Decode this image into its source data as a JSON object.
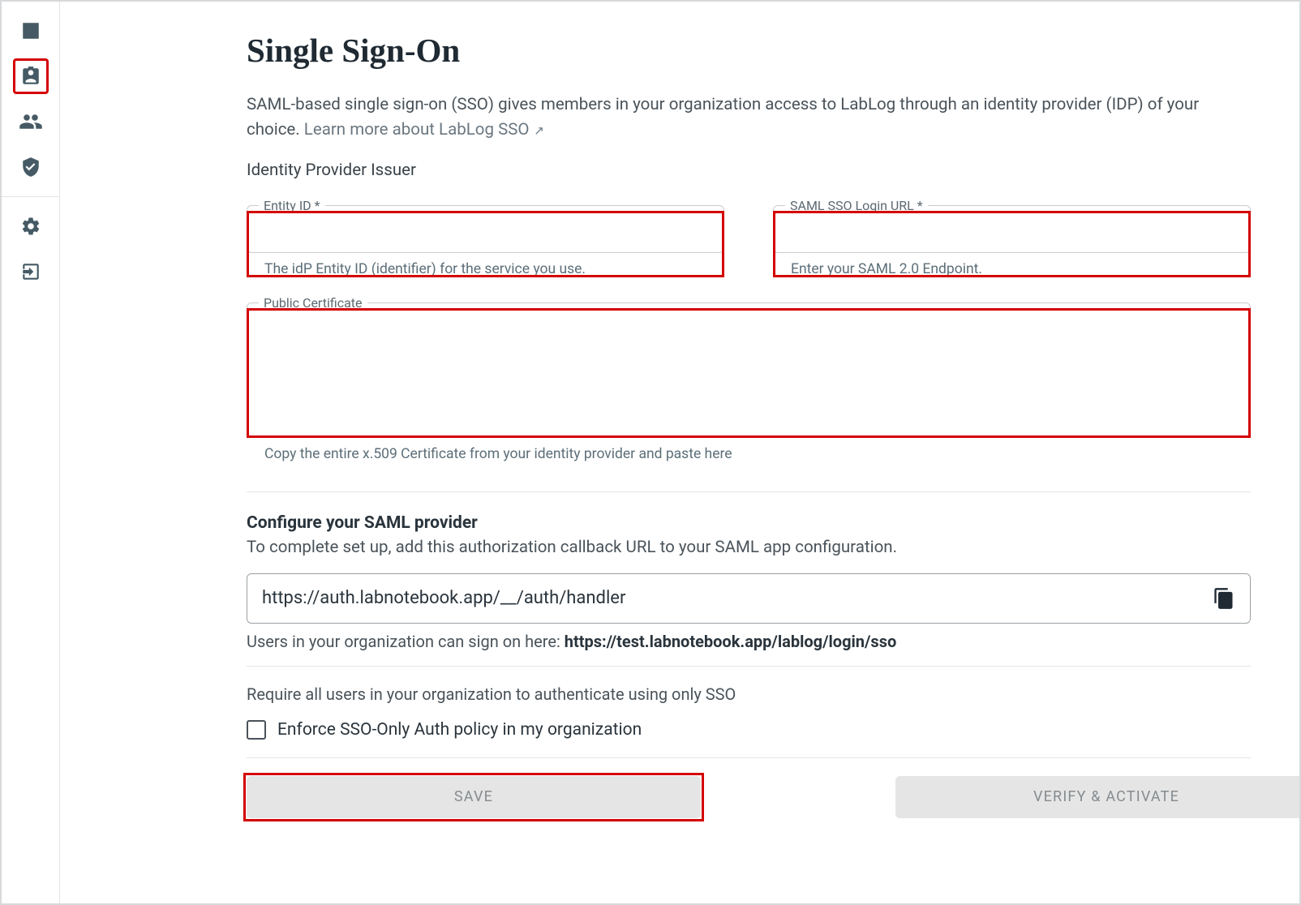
{
  "page": {
    "title": "Single Sign-On",
    "intro_text": "SAML-based single sign-on (SSO) gives members in your organization access to LabLog through an identity provider (IDP) of your choice. ",
    "learn_more": "Learn more about LabLog SSO",
    "section_label": "Identity Provider Issuer"
  },
  "fields": {
    "entity_id": {
      "label": "Entity ID *",
      "value": "",
      "helper": "The idP Entity ID (identifier) for the service you use."
    },
    "login_url": {
      "label": "SAML SSO Login URL *",
      "value": "",
      "helper": "Enter your SAML 2.0 Endpoint."
    },
    "public_cert": {
      "label": "Public Certificate",
      "value": "",
      "helper": "Copy the entire x.509 Certificate from your identity provider and paste here"
    }
  },
  "configure": {
    "heading": "Configure your SAML provider",
    "subtext": "To complete set up, add this authorization callback URL to your SAML app configuration.",
    "callback_url": "https://auth.labnotebook.app/__/auth/handler",
    "signon_prefix": "Users in your organization can sign on here: ",
    "signon_url": "https://test.labnotebook.app/lablog/login/sso"
  },
  "enforce": {
    "note": "Require all users in your organization to authenticate using only SSO",
    "checkbox_label": "Enforce SSO-Only Auth policy in my organization",
    "checked": false
  },
  "buttons": {
    "save": "SAVE",
    "verify": "VERIFY & ACTIVATE"
  }
}
